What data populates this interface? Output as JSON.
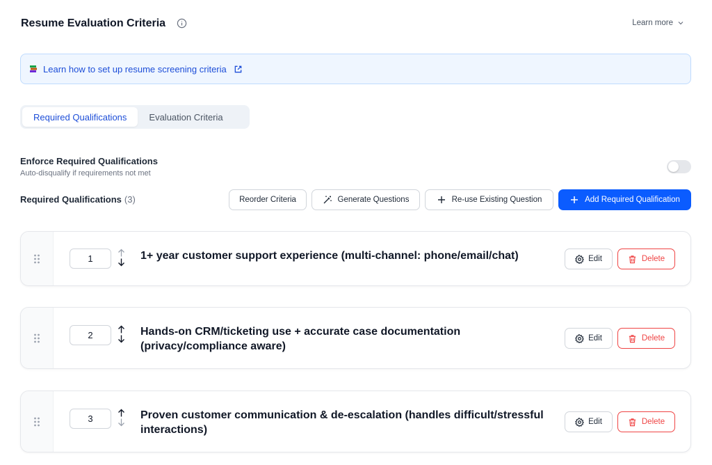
{
  "header": {
    "title": "Resume Evaluation Criteria",
    "info_icon": "info-icon",
    "learn_more": "Learn more"
  },
  "banner": {
    "icon": "book-icon",
    "link_text": "Learn how to set up resume screening criteria",
    "external_icon": "external-link-icon"
  },
  "tabs": [
    {
      "label": "Required Qualifications",
      "active": true
    },
    {
      "label": "Evaluation Criteria",
      "active": false
    }
  ],
  "enforce": {
    "title": "Enforce Required Qualifications",
    "subtitle": "Auto-disqualify if requirements not met",
    "enabled": false
  },
  "required_qualifications": {
    "label": "Required Qualifications",
    "count": "(3)"
  },
  "toolbar": {
    "reorder": "Reorder Criteria",
    "generate": "Generate Questions",
    "reuse": "Re-use Existing Question",
    "add": "Add Required Qualification"
  },
  "qualifications": [
    {
      "number": "1",
      "text": "1+ year customer support experience (multi-channel: phone/email/chat)",
      "edit": "Edit",
      "delete": "Delete"
    },
    {
      "number": "2",
      "text": "Hands-on CRM/ticketing use + accurate case documentation (privacy/compliance aware)",
      "edit": "Edit",
      "delete": "Delete"
    },
    {
      "number": "3",
      "text": "Proven customer communication & de-escalation (handles difficult/stressful interactions)",
      "edit": "Edit",
      "delete": "Delete"
    }
  ],
  "colors": {
    "primary": "#0b5cff",
    "link": "#1d4ed8",
    "danger": "#ef4444",
    "banner_bg": "#eff6ff"
  }
}
